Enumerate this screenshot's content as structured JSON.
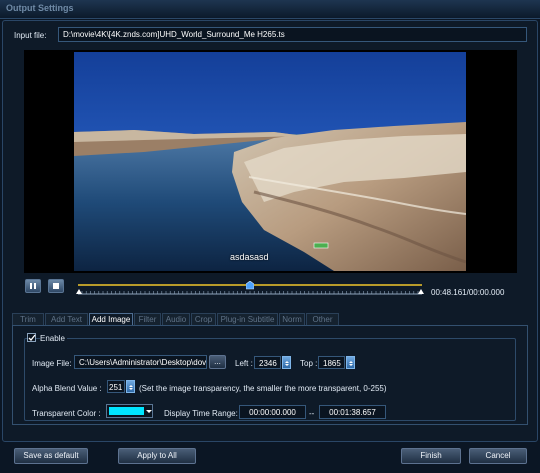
{
  "window": {
    "title": "Output Settings"
  },
  "input": {
    "label": "Input file:",
    "path": "D:\\movie\\4K\\[4K.znds.com]UHD_World_Surround_Me H265.ts"
  },
  "preview": {
    "overlay_text": "asdasasd",
    "time_display": "00:48.161/00:00.000",
    "progress": 0.5
  },
  "tabs": [
    "Trim",
    "Add Text",
    "Add Image",
    "Filter",
    "Audio",
    "Crop",
    "Plug-in Subtitle",
    "Norm",
    "Other"
  ],
  "active_tab": "Add Image",
  "add_image": {
    "enable_label": "Enable",
    "enable_checked": true,
    "image_file_label": "Image File:",
    "image_file_value": "C:\\Users\\Administrator\\Desktop\\dov",
    "browse_label": "...",
    "left_label": "Left :",
    "left_value": "2346",
    "top_label": "Top :",
    "top_value": "1865",
    "alpha_label": "Alpha Blend Value :",
    "alpha_value": "251",
    "alpha_hint": "(Set the image transparency, the smaller the more transparent, 0-255)",
    "transparent_color_label": "Transparent Color :",
    "transparent_color": "#00e5ff",
    "display_time_label": "Display Time Range:",
    "time_start": "00:00:00.000",
    "time_separator": "--",
    "time_end": "00:01:38.657"
  },
  "footer": {
    "save_default": "Save as default",
    "apply_all": "Apply to All",
    "finish": "Finish",
    "cancel": "Cancel"
  },
  "colors": {
    "accent": "#f0c62a",
    "background": "#0b1624"
  }
}
